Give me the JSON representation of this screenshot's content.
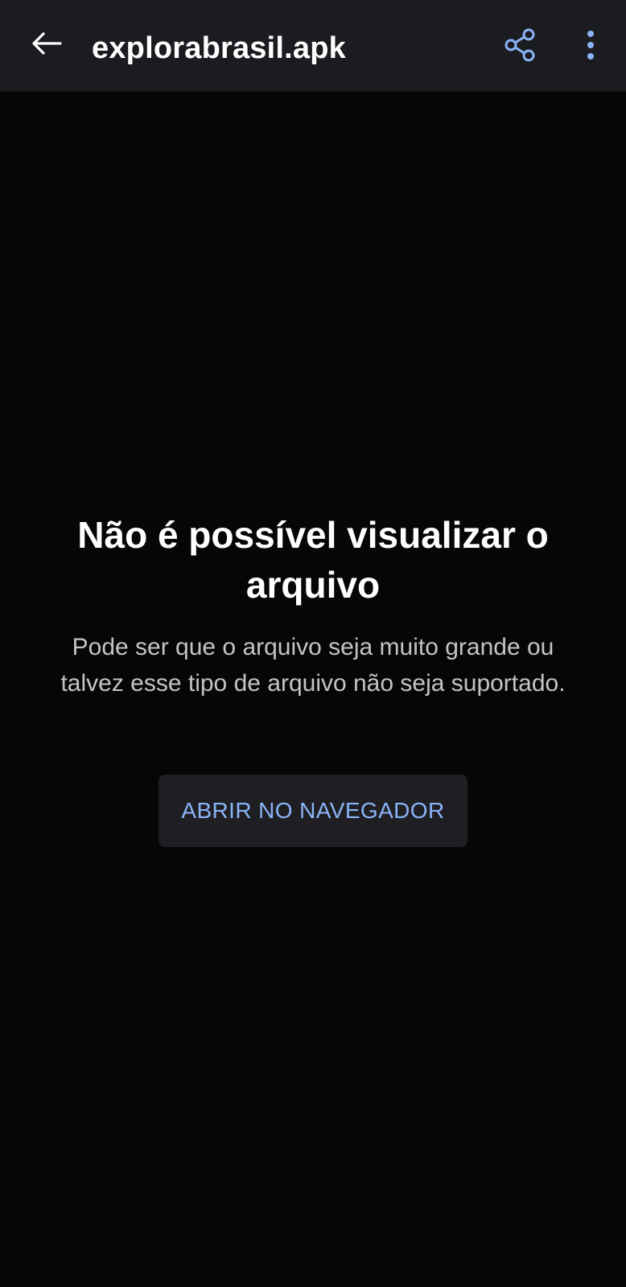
{
  "app_bar": {
    "title": "explorabrasil.apk",
    "back_icon": "arrow-left-icon",
    "share_icon": "share-icon",
    "more_icon": "more-vertical-icon",
    "accent_color": "#8ab4f8"
  },
  "error": {
    "title": "Não é possível visualizar o arquivo",
    "message": "Pode ser que o arquivo seja muito grande ou talvez esse tipo de arquivo não seja suportado.",
    "button_label": "ABRIR NO NAVEGADOR"
  },
  "colors": {
    "background": "#060606",
    "app_bar": "#1b1c20",
    "button_bg": "#1f1f23",
    "button_text": "#8ab4f8"
  }
}
